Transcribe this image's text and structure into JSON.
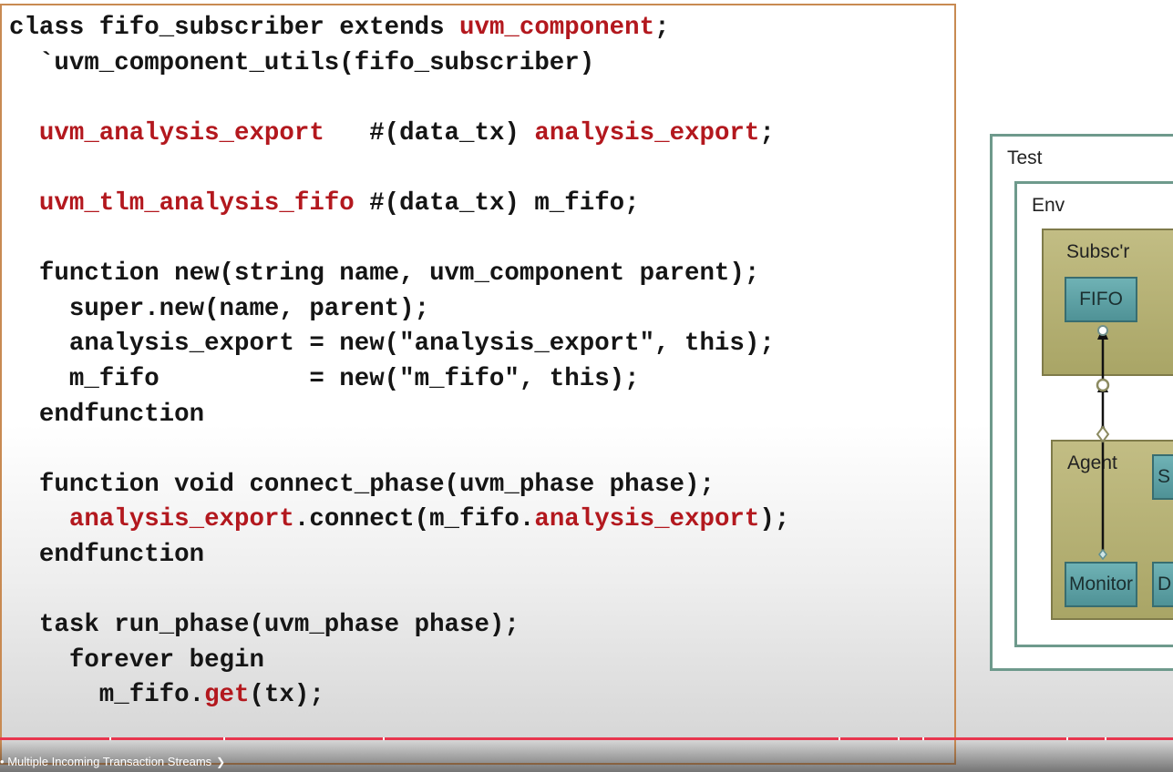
{
  "code": {
    "lines": [
      [
        {
          "t": "class fifo_subscriber extends "
        },
        {
          "t": "uvm_component",
          "c": "red"
        },
        {
          "t": ";"
        }
      ],
      [
        {
          "t": "  `uvm_component_utils(fifo_subscriber)"
        }
      ],
      [
        {
          "t": ""
        }
      ],
      [
        {
          "t": "  "
        },
        {
          "t": "uvm_analysis_export",
          "c": "red"
        },
        {
          "t": "   #(data_tx) "
        },
        {
          "t": "analysis_export",
          "c": "red"
        },
        {
          "t": ";"
        }
      ],
      [
        {
          "t": ""
        }
      ],
      [
        {
          "t": "  "
        },
        {
          "t": "uvm_tlm_analysis_fifo",
          "c": "red"
        },
        {
          "t": " #(data_tx) m_fifo;"
        }
      ],
      [
        {
          "t": ""
        }
      ],
      [
        {
          "t": "  function new(string name, uvm_component parent);"
        }
      ],
      [
        {
          "t": "    super.new(name, parent);"
        }
      ],
      [
        {
          "t": "    analysis_export = new(\"analysis_export\", this);"
        }
      ],
      [
        {
          "t": "    m_fifo          = new(\"m_fifo\", this);"
        }
      ],
      [
        {
          "t": "  endfunction"
        }
      ],
      [
        {
          "t": ""
        }
      ],
      [
        {
          "t": "  function void connect_phase(uvm_phase phase);"
        }
      ],
      [
        {
          "t": "    "
        },
        {
          "t": "analysis_export",
          "c": "red"
        },
        {
          "t": ".connect(m_fifo."
        },
        {
          "t": "analysis_export",
          "c": "red"
        },
        {
          "t": ");"
        }
      ],
      [
        {
          "t": "  endfunction"
        }
      ],
      [
        {
          "t": ""
        }
      ],
      [
        {
          "t": "  task run_phase(uvm_phase phase);"
        }
      ],
      [
        {
          "t": "    forever begin"
        }
      ],
      [
        {
          "t": "      m_fifo."
        },
        {
          "t": "get",
          "c": "red"
        },
        {
          "t": "(tx);"
        }
      ]
    ]
  },
  "diagram": {
    "test_label": "Test",
    "env_label": "Env",
    "subscriber_label": "Subsc'r",
    "fifo_label": "FIFO",
    "agent_label": "Agent",
    "monitor_label": "Monitor",
    "s_label": "S",
    "d_label": "D"
  },
  "player": {
    "chapter_title": "Multiple Incoming Transaction Streams",
    "chapter_prefix": "•",
    "accent_color": "#e8364f"
  }
}
